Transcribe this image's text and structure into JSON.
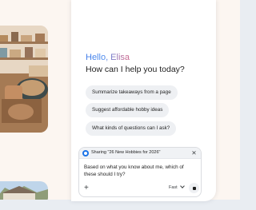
{
  "assistant": {
    "greeting": "Hello, Elisa",
    "subheading": "How can I help you today?",
    "suggestions": [
      "Summarize takeaways from a page",
      "Suggest affordable hobby ideas",
      "What kinds of questions can I ask?"
    ],
    "sharing_label": "Sharing \"26 New Hobbies for 2026\"",
    "prompt": "Based on what you know about me, which of these should I try?",
    "mode": "Fast"
  },
  "icons": {
    "share": "share-page-icon",
    "close": "close-icon",
    "add": "add-icon",
    "mode_dropdown": "chevron-down-icon",
    "stop": "stop-icon"
  },
  "colors": {
    "greeting_gradient_start": "#3f7ae8",
    "greeting_gradient_end": "#c56790",
    "chip_background": "#eef0f3",
    "share_icon": "#1a73e8"
  }
}
